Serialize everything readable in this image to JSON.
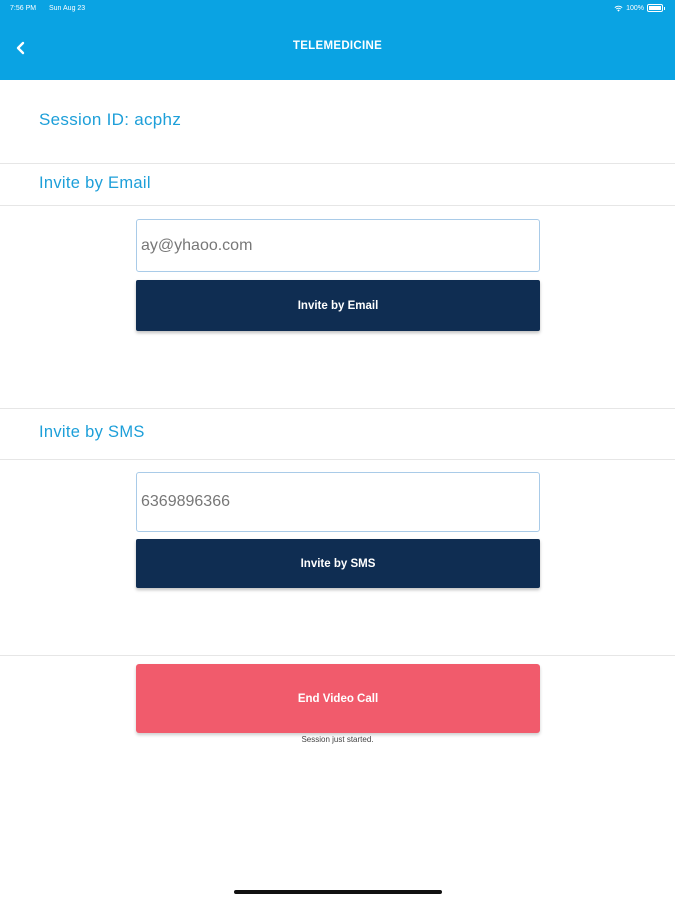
{
  "status_bar": {
    "time": "7:56 PM",
    "date": "Sun Aug 23",
    "battery": "100%"
  },
  "header": {
    "title": "TELEMEDICINE",
    "back_icon": "chevron-left-icon"
  },
  "session": {
    "label": "Session ID: acphz",
    "status": "Session just started."
  },
  "email_section": {
    "title": "Invite by Email",
    "input_value": "ay@yhaoo.com",
    "button_label": "Invite by Email"
  },
  "sms_section": {
    "title": "Invite by SMS",
    "input_value": "6369896366",
    "button_label": "Invite by SMS"
  },
  "end_call": {
    "label": "End Video Call"
  },
  "colors": {
    "header": "#0aa3e3",
    "accent_text": "#1d9fd9",
    "primary_button": "#0f2d52",
    "danger_button": "#f15b6c"
  }
}
